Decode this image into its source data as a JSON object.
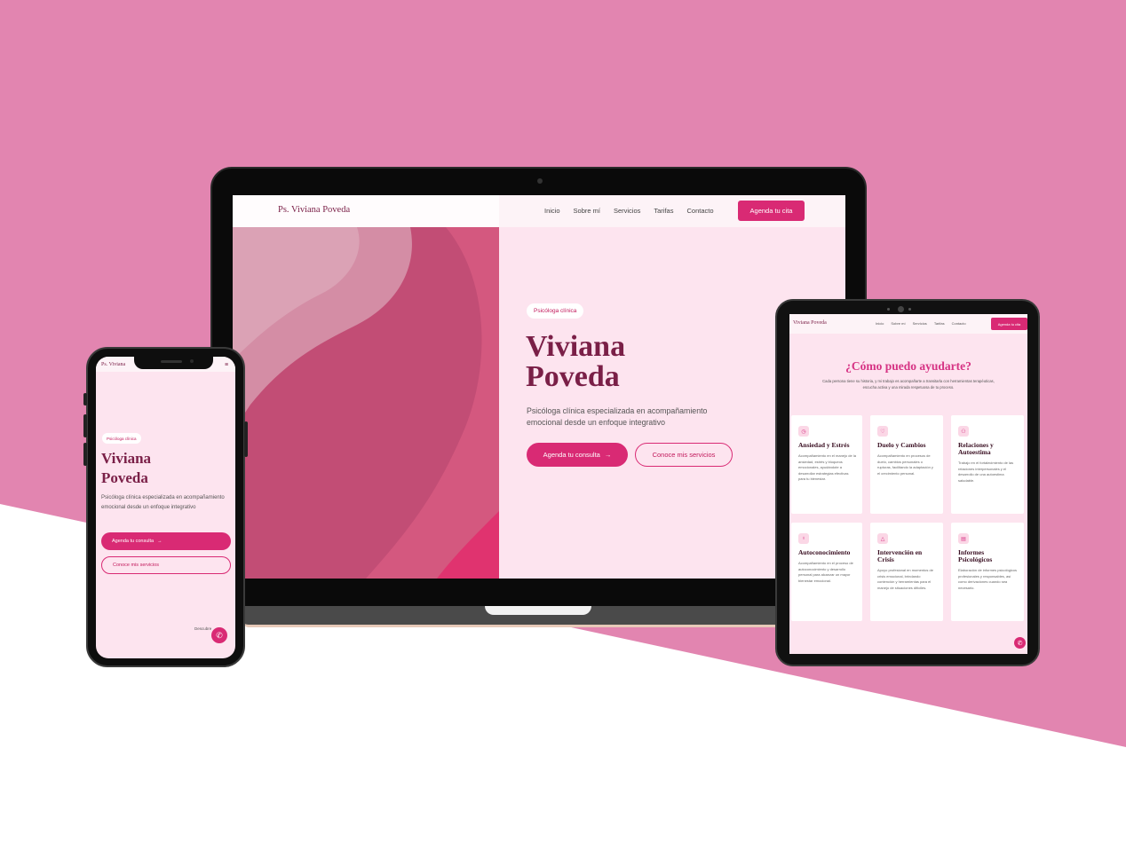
{
  "colors": {
    "background_pink": "#e285b0",
    "brand_primary": "#d92a74",
    "brand_dark": "#7a1f47",
    "hero_bg": "#fde4ef",
    "heading_pink": "#d63384"
  },
  "laptop": {
    "brand": "Ps. Viviana Poveda",
    "nav": [
      "Inicio",
      "Sobre mí",
      "Servicios",
      "Tarifas",
      "Contacto"
    ],
    "cta": "Agenda tu cita",
    "badge": "Psicóloga clínica",
    "title_line1": "Viviana",
    "title_line2": "Poveda",
    "description": "Psicóloga clínica especializada en acompañamiento emocional desde un enfoque integrativo",
    "primary_button": "Agenda tu consulta",
    "secondary_button": "Conoce mis servicios",
    "arrow_icon": "arrow-right-icon"
  },
  "tablet": {
    "brand": "Viviana Poveda",
    "nav": [
      "Inicio",
      "Sobre mí",
      "Servicios",
      "Tarifas",
      "Contacto"
    ],
    "cta": "Agenda tu cita",
    "section_title": "¿Cómo puedo ayudarte?",
    "section_subtitle": "Cada persona tiene su historia, y mi trabajo es acompañarte a transitarla con herramientas terapéuticas, escucha activa y una mirada respetuosa de tu proceso.",
    "services": [
      {
        "icon": "clock-icon",
        "title": "Ansiedad y Estrés",
        "description": "Acompañamiento en el manejo de la ansiedad, estrés y bloqueos emocionales, ayudándote a desarrollar estrategias efectivas para tu bienestar."
      },
      {
        "icon": "heart-icon",
        "title": "Duelo y Cambios",
        "description": "Acompañamiento en procesos de duelo, cambios personales o rupturas, facilitando la adaptación y el crecimiento personal."
      },
      {
        "icon": "people-icon",
        "title": "Relaciones y Autoestima",
        "description": "Trabajo en el fortalecimiento de las relaciones interpersonales y el desarrollo de una autoestima saludable."
      },
      {
        "icon": "lightbulb-icon",
        "title": "Autoconocimiento",
        "description": "Acompañamiento en el proceso de autoconocimiento y desarrollo personal para alcanzar un mayor bienestar emocional."
      },
      {
        "icon": "alert-icon",
        "title": "Intervención en Crisis",
        "description": "Apoyo profesional en momentos de crisis emocional, brindando contención y herramientas para el manejo de situaciones difíciles."
      },
      {
        "icon": "document-icon",
        "title": "Informes Psicológicos",
        "description": "Elaboración de informes psicológicos profesionales y responsables, así como derivaciones cuando sea necesario."
      }
    ]
  },
  "phone": {
    "brand": "Ps. Viviana",
    "menu_icon": "hamburger-menu-icon",
    "badge": "Psicóloga clínica",
    "title_line1": "Viviana",
    "title_line2": "Poveda",
    "description": "Psicóloga clínica especializada en acompañamiento emocional desde un enfoque integrativo",
    "primary_button": "Agenda tu consulta",
    "secondary_button": "Conoce mis servicios",
    "scroll_hint": "Descubre"
  }
}
